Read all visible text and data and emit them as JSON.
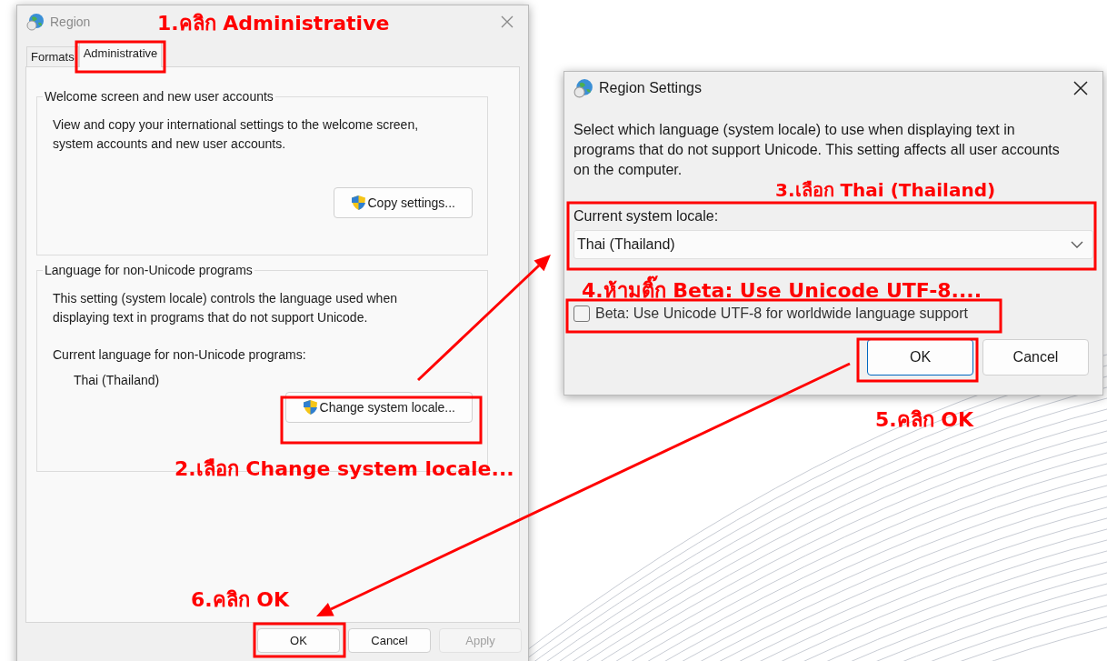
{
  "region_window": {
    "title": "Region",
    "tabs": [
      {
        "label": "Formats",
        "selected": false
      },
      {
        "label": "Administrative",
        "selected": true
      }
    ],
    "groups": [
      {
        "title": "Welcome screen and new user accounts",
        "description": "View and copy your international settings to the welcome screen, system accounts and new user accounts.",
        "button": "Copy settings..."
      },
      {
        "title": "Language for non-Unicode programs",
        "description": "This setting (system locale) controls the language used when displaying text in programs that do not support Unicode.",
        "current_label": "Current language for non-Unicode programs:",
        "current_value": "Thai (Thailand)",
        "button": "Change system locale..."
      }
    ],
    "buttons": [
      {
        "label": "OK",
        "disabled": false
      },
      {
        "label": "Cancel",
        "disabled": false
      },
      {
        "label": "Apply",
        "disabled": true
      }
    ]
  },
  "settings_window": {
    "title": "Region Settings",
    "description": "Select which language (system locale) to use when displaying text in programs that do not support Unicode. This setting affects all user accounts on the computer.",
    "locale_label": "Current system locale:",
    "locale_value": "Thai (Thailand)",
    "checkbox": {
      "label": "Beta: Use Unicode UTF-8 for worldwide language support",
      "checked": false
    },
    "buttons": [
      {
        "label": "OK",
        "default": true
      },
      {
        "label": "Cancel",
        "default": false
      }
    ]
  },
  "annotations": [
    "1.คลิก Administrative",
    "2.เลือก Change system locale...",
    "3.เลือก Thai (Thailand)",
    "4.ห้ามติ๊ก Beta: Use Unicode UTF-8....",
    "5.คลิก OK",
    "6.คลิก OK"
  ]
}
